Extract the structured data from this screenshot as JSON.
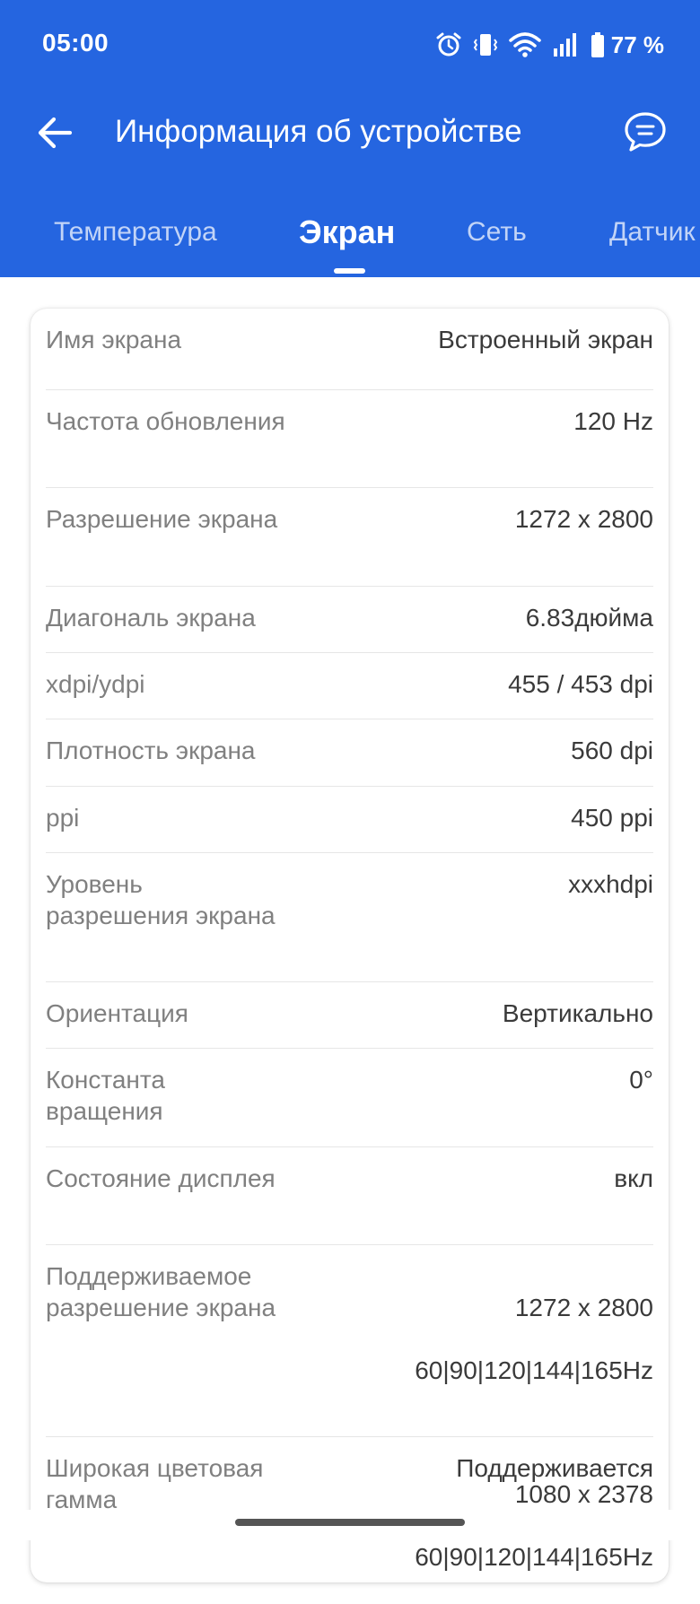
{
  "status_bar": {
    "time": "05:00",
    "battery": "77 %",
    "icons": [
      "alarm-icon",
      "vibrate-icon",
      "wifi-icon",
      "signal-icon",
      "battery-icon"
    ]
  },
  "header": {
    "title": "Информация об устройстве",
    "back_icon": "arrow-left-icon",
    "feedback_icon": "chat-icon",
    "color": "#2565E0"
  },
  "tabs": [
    {
      "label": "Температура",
      "active": false
    },
    {
      "label": "Экран",
      "active": true
    },
    {
      "label": "Сеть",
      "active": false
    },
    {
      "label": "Датчик",
      "active": false
    }
  ],
  "rows": [
    {
      "label": "Имя экрана",
      "value": "Встроенный экран"
    },
    {
      "label": "Частота обновления",
      "value": "120 Hz"
    },
    {
      "label": "Разрешение экрана",
      "value": "1272 x 2800"
    },
    {
      "label": "Диагональ экрана",
      "value": "6.83дюйма"
    },
    {
      "label": "xdpi/ydpi",
      "value": "455 / 453 dpi"
    },
    {
      "label": "Плотность экрана",
      "value": "560 dpi"
    },
    {
      "label": "ppi",
      "value": "450 ppi"
    },
    {
      "label": "Уровень разрешения экрана",
      "value": "xxxhdpi"
    },
    {
      "label": "Ориентация",
      "value": "Вертикально"
    },
    {
      "label": "Константа вращения",
      "value": "0°"
    },
    {
      "label": "Состояние дисплея",
      "value": "вкл"
    },
    {
      "label": "Поддерживаемое разрешение экрана",
      "value_lines": [
        "1272 x 2800",
        "60|90|120|144|165Hz",
        "1080 x 2378",
        "60|90|120|144|165Hz"
      ]
    },
    {
      "label": "Широкая цветовая гамма",
      "value": "Поддерживается"
    }
  ]
}
